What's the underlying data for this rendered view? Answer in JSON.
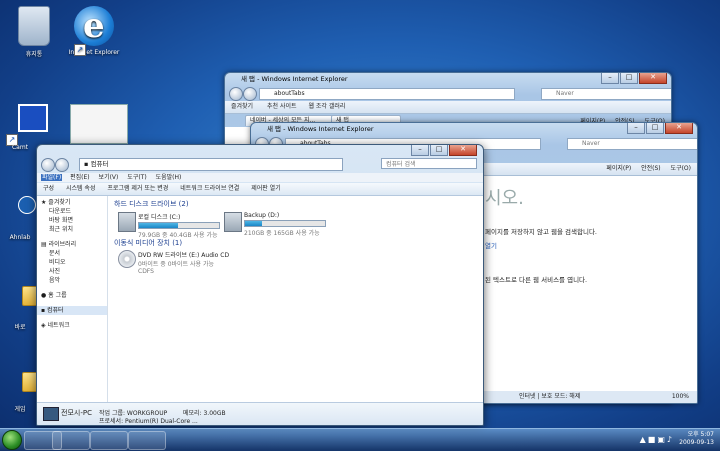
{
  "desktop": {
    "icons": [
      {
        "label": "휴지통"
      },
      {
        "label": "Internet Explorer"
      },
      {
        "label": "Camt"
      },
      {
        "label": "Ahnlab"
      },
      {
        "label": "바로"
      },
      {
        "label": "게임"
      }
    ]
  },
  "ie_back": {
    "title": "새 탭 - Windows Internet Explorer",
    "address": "aboutTabs",
    "search_placeholder": "Naver",
    "favorites_label": "즐겨찾기",
    "suggested_sites": "추천 사이트",
    "web_slice": "웹 조각 갤러리",
    "tab1": "네이버 - 세상의 모든 지...",
    "tab2": "새 탭",
    "tools": [
      "페이지(P)",
      "안전(S)",
      "도구(O)"
    ]
  },
  "ie_front": {
    "title": "새 탭 - Windows Internet Explorer",
    "address": "aboutTabs",
    "search_placeholder": "Naver",
    "tools": [
      "페이지(P)",
      "안전(S)",
      "도구(O)"
    ],
    "heading": "시오.",
    "line1": "페이지를 저장하지 않고 웹을 검색합니다.",
    "line2": "열기",
    "line3": "된 텍스트로 다른 웹 서비스를 엽니다.",
    "status_internet": "인터넷 | 보호 모드: 해제",
    "zoom": "100%"
  },
  "explorer": {
    "breadcrumb": "컴퓨터",
    "search_placeholder": "컴퓨터 검색",
    "menu": [
      "파일(F)",
      "편집(E)",
      "보기(V)",
      "도구(T)",
      "도움말(H)"
    ],
    "commands": [
      "구성",
      "시스템 속성",
      "프로그램 제거 또는 변경",
      "네트워크 드라이브 연결",
      "제어판 열기"
    ],
    "nav": {
      "favorites": "즐겨찾기",
      "downloads": "다운로드",
      "desktop": "바탕 화면",
      "recent": "최근 위치",
      "libraries": "라이브러리",
      "documents": "문서",
      "videos": "비디오",
      "pictures": "사진",
      "music": "음악",
      "homegroup": "홈 그룹",
      "computer": "컴퓨터",
      "network": "네트워크"
    },
    "hdd_section": "하드 디스크 드라이브 (2)",
    "removable_section": "이동식 미디어 장치 (1)",
    "drive_c": {
      "name": "로컬 디스크 (C:)",
      "free": "79.9GB 중 40.4GB 사용 가능",
      "used_fraction": 0.49
    },
    "drive_d": {
      "name": "Backup (D:)",
      "free": "210GB 중 165GB 사용 가능",
      "used_fraction": 0.21
    },
    "dvd": {
      "name": "DVD RW 드라이브 (E:) Audio CD",
      "line1": "0바이트 중 0바이트 사용 가능",
      "line2": "CDFS"
    },
    "details": {
      "pc_name": "전모시-PC",
      "workgroup": "작업 그룹: WORKGROUP",
      "memory": "메모리: 3.00GB",
      "processor": "프로세서: Pentium(R) Dual-Core ..."
    }
  },
  "taskbar": {
    "time": "오후 5:07",
    "date": "2009-09-13"
  }
}
